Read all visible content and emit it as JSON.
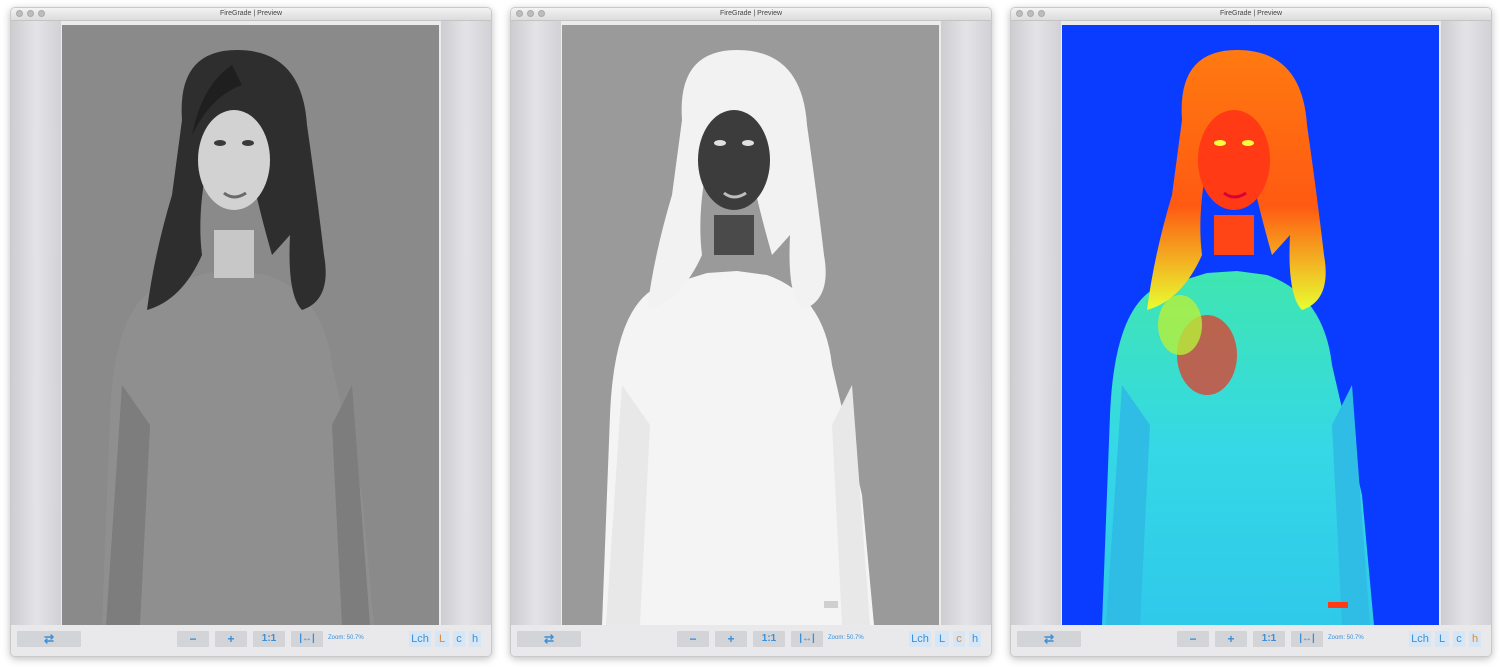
{
  "colors": {
    "accent": "#3a8fd8",
    "channel_active": "#e5872e",
    "heatmap_background": "#0a3cff"
  },
  "windows": [
    {
      "title": "FireGrade | Preview",
      "view": "grayscale luminance",
      "toolbar": {
        "swap_icon": "swap-arrows-icon",
        "zoom_out": "−",
        "zoom_in": "+",
        "actual_size": "1:1",
        "fit": "|↔|",
        "zoom_text": "Zoom: 50.7%",
        "channels": [
          "Lch",
          "L",
          "c",
          "h"
        ],
        "active_channel": "L"
      }
    },
    {
      "title": "FireGrade | Preview",
      "view": "inverted luminance",
      "toolbar": {
        "swap_icon": "swap-arrows-icon",
        "zoom_out": "−",
        "zoom_in": "+",
        "actual_size": "1:1",
        "fit": "|↔|",
        "zoom_text": "Zoom: 50.7%",
        "channels": [
          "Lch",
          "L",
          "c",
          "h"
        ],
        "active_channel": "c"
      }
    },
    {
      "title": "FireGrade | Preview",
      "view": "false-color hue",
      "toolbar": {
        "swap_icon": "swap-arrows-icon",
        "zoom_out": "−",
        "zoom_in": "+",
        "actual_size": "1:1",
        "fit": "|↔|",
        "zoom_text": "Zoom: 50.7%",
        "channels": [
          "Lch",
          "L",
          "c",
          "h"
        ],
        "active_channel": "h"
      }
    }
  ]
}
